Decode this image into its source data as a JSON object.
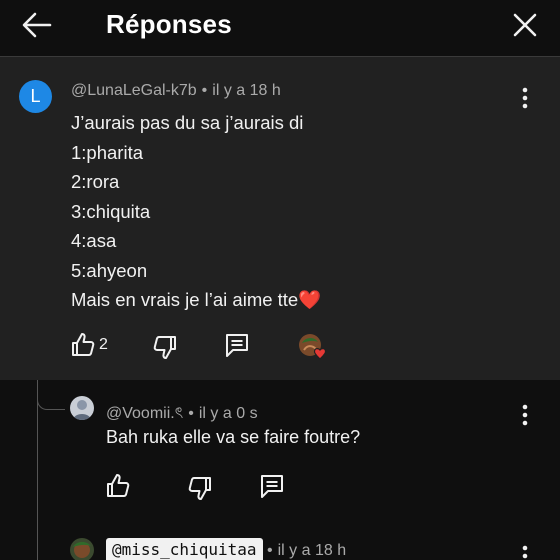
{
  "header": {
    "title": "Réponses"
  },
  "comment": {
    "avatar_letter": "L",
    "author": "@LunaLeGal-k7b",
    "separator": "•",
    "time": "il y a 18 h",
    "lines": [
      "J’aurais pas du sa j’aurais di",
      "1:pharita",
      "2:rora",
      "3:chiquita",
      "4:asa",
      "5:ahyeon",
      "Mais en vrais je l’ai aime tte❤️"
    ],
    "likes": "2"
  },
  "reply1": {
    "author": "@Voomii.ৎ",
    "separator": "•",
    "time": "il y a 0 s",
    "text": "Bah ruka elle va se faire foutre?"
  },
  "reply2": {
    "author": "@miss_chiquitaa",
    "separator": "•",
    "time": "il y a 18 h"
  },
  "colors": {
    "background": "#0f0f0f",
    "comment_background": "#212121",
    "avatar_blue": "#1e88e5",
    "heart_red": "#e53935"
  }
}
